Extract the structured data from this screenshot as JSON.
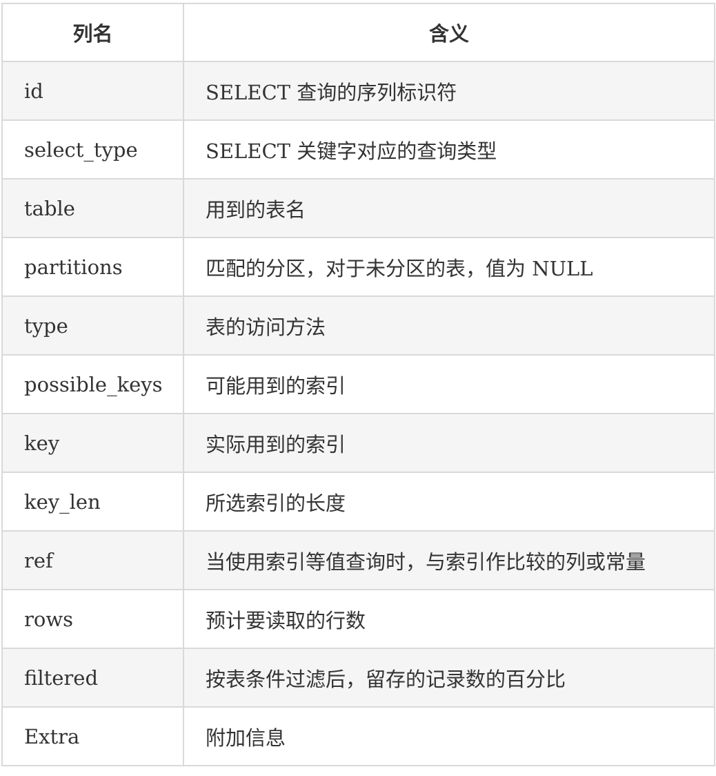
{
  "table": {
    "headers": [
      "列名",
      "含义"
    ],
    "rows": [
      {
        "column": "id",
        "meaning": "SELECT 查询的序列标识符"
      },
      {
        "column": "select_type",
        "meaning": "SELECT 关键字对应的查询类型"
      },
      {
        "column": "table",
        "meaning": "用到的表名"
      },
      {
        "column": "partitions",
        "meaning": "匹配的分区，对于未分区的表，值为 NULL"
      },
      {
        "column": "type",
        "meaning": "表的访问方法"
      },
      {
        "column": "possible_keys",
        "meaning": "可能用到的索引"
      },
      {
        "column": "key",
        "meaning": "实际用到的索引"
      },
      {
        "column": "key_len",
        "meaning": "所选索引的长度"
      },
      {
        "column": "ref",
        "meaning": "当使用索引等值查询时，与索引作比较的列或常量"
      },
      {
        "column": "rows",
        "meaning": "预计要读取的行数"
      },
      {
        "column": "filtered",
        "meaning": "按表条件过滤后，留存的记录数的百分比"
      },
      {
        "column": "Extra",
        "meaning": "附加信息"
      }
    ]
  }
}
